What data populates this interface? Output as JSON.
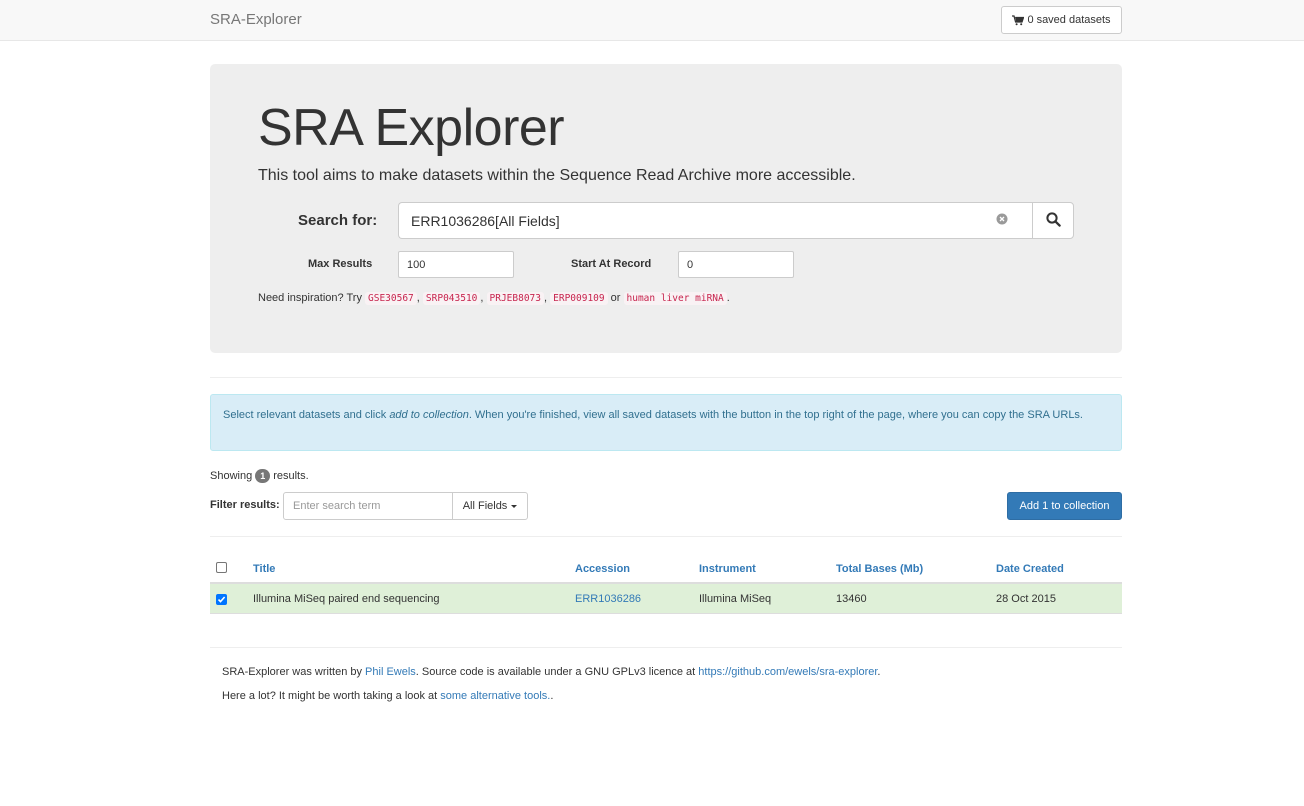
{
  "navbar": {
    "brand": "SRA-Explorer",
    "saved_count": "0",
    "saved_label": "saved datasets",
    "cart_icon": "shopping-cart-icon"
  },
  "jumbotron": {
    "title": "SRA Explorer",
    "lead": "This tool aims to make datasets within the Sequence Read Archive more accessible.",
    "search_label": "Search for:",
    "search_value": "ERR1036286[All Fields]",
    "clear_icon": "clear-circle-icon",
    "search_icon": "magnifier-icon",
    "max_results_label": "Max Results",
    "max_results_value": "100",
    "start_label": "Start At Record",
    "start_value": "0",
    "inspiration_prefix": "Need inspiration? Try",
    "examples": [
      "GSE30567",
      "SRP043510",
      "PRJEB8073",
      "ERP009109"
    ],
    "or_text": "or",
    "example_last": "human liver miRNA"
  },
  "alert": {
    "text_before": "Select relevant datasets and click ",
    "text_em": "add to collection",
    "text_after": ". When you're finished, view all saved datasets with the button in the top right of the page, where you can copy the SRA URLs."
  },
  "results": {
    "showing_prefix": "Showing",
    "count": "1",
    "showing_suffix": "results.",
    "filter_label": "Filter results:",
    "filter_placeholder": "Enter search term",
    "field_select": "All Fields",
    "add_button": "Add 1 to collection"
  },
  "table": {
    "headers": [
      "Title",
      "Accession",
      "Instrument",
      "Total Bases (Mb)",
      "Date Created"
    ],
    "rows": [
      {
        "checked": true,
        "title": "Illumina MiSeq paired end sequencing",
        "accession": "ERR1036286",
        "instrument": "Illumina MiSeq",
        "bases": "13460",
        "date": "28 Oct 2015"
      }
    ]
  },
  "footer": {
    "line1_prefix": "SRA-Explorer was written by ",
    "author": "Phil Ewels",
    "line1_mid": ". Source code is available under a GNU GPLv3 licence at ",
    "repo": "https://github.com/ewels/sra-explorer",
    "line1_end": ".",
    "line2_prefix": "Here a lot? It might be worth taking a look at ",
    "alt_link": "some alternative tools.",
    "line2_end": "."
  },
  "colors": {
    "primary": "#337ab7",
    "success_row": "#dff0d8",
    "info_bg": "#d9edf7",
    "code_red": "#c7254e"
  }
}
